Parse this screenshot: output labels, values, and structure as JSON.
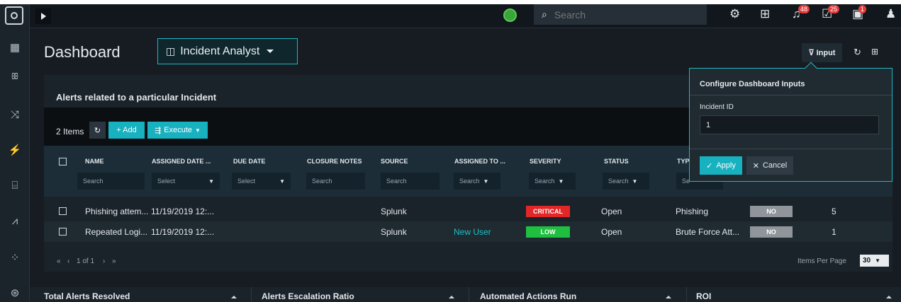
{
  "topbar": {
    "search_placeholder": "Search",
    "notifications": [
      {
        "name": "bell",
        "count": "48"
      },
      {
        "name": "tasks",
        "count": "25"
      },
      {
        "name": "alerts",
        "count": "1"
      }
    ]
  },
  "header": {
    "title": "Dashboard",
    "dashboard_select": "Incident Analyst",
    "input_label": "Input"
  },
  "widget": {
    "title": "Alerts related to a particular Incident",
    "items_count": "2 Items",
    "add_label": "+ Add",
    "execute_label": "Execute",
    "columns": [
      {
        "label": "NAME",
        "filter": "Search"
      },
      {
        "label": "ASSIGNED DATE ...",
        "filter": "Select"
      },
      {
        "label": "DUE DATE",
        "filter": "Select"
      },
      {
        "label": "CLOSURE NOTES",
        "filter": "Search"
      },
      {
        "label": "SOURCE",
        "filter": "Search"
      },
      {
        "label": "ASSIGNED TO ...",
        "filter": "Search"
      },
      {
        "label": "SEVERITY",
        "filter": "Search"
      },
      {
        "label": "STATUS",
        "filter": "Search"
      },
      {
        "label": "TYP",
        "filter": "Se"
      }
    ],
    "rows": [
      {
        "name": "Phishing attem...",
        "assigned_date": "11/19/2019 12:...",
        "source": "Splunk",
        "assigned_to": "",
        "severity": "CRITICAL",
        "status": "Open",
        "type": "Phishing",
        "flag": "NO",
        "count": "5"
      },
      {
        "name": "Repeated Logi...",
        "assigned_date": "11/19/2019 12:...",
        "source": "Splunk",
        "assigned_to": "New User",
        "severity": "LOW",
        "status": "Open",
        "type": "Brute Force Att...",
        "flag": "NO",
        "count": "1"
      }
    ],
    "pagination": "1 of 1",
    "items_per_page_label": "Items Per Page",
    "items_per_page_value": "30"
  },
  "bottom_cards": [
    "Total Alerts Resolved",
    "Alerts Escalation Ratio",
    "Automated Actions Run",
    "ROI"
  ],
  "popover": {
    "title": "Configure Dashboard Inputs",
    "field_label": "Incident ID",
    "field_value": "1",
    "apply_label": "Apply",
    "cancel_label": "Cancel"
  },
  "colors": {
    "accent": "#17b1c0",
    "critical": "#e32626",
    "low": "#1fbf3f",
    "assigned_link": "#1fc0c9"
  }
}
